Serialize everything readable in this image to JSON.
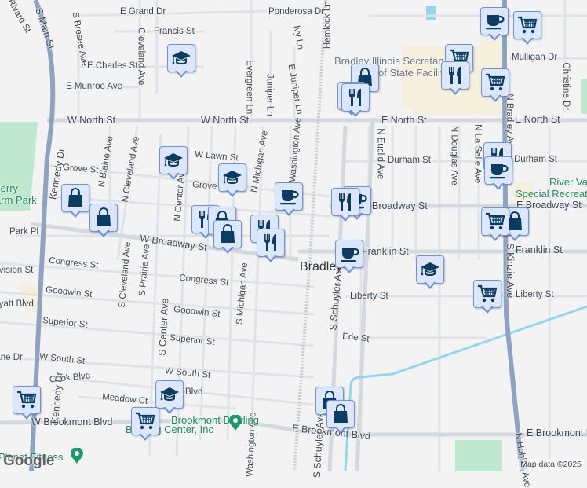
{
  "map": {
    "streets": [
      "E Grand Dr",
      "Francis St",
      "Ponderosa Dr",
      "Hemlock Ln",
      "Ivy Ln",
      "S Bresee Ave",
      "Cleveland Ave",
      "E Charles St",
      "E Munroe Ave",
      "Evergreen Ln",
      "Juniper Ln",
      "E Juniper Ln",
      "W North St",
      "W North St",
      "E North St",
      "E North St",
      "Mulligan Dr",
      "Christine Dr",
      "N Bradley Ave",
      "N Euclid Ave",
      "N Douglas Ave",
      "N La Salle Ave",
      "Durham St",
      "Durham St",
      "N Blaine Ave",
      "N Cleveland Ave",
      "W Lawn St",
      "Grove St",
      "Grove St",
      "N Center Ave",
      "N Michigan Ave",
      "Washington Ave",
      "E Broadway St",
      "Broadway St",
      "Park Pl",
      "W Broadway St",
      "Congress St",
      "Congress St",
      "Division St",
      "S Cleveland Ave",
      "S Prairie Ave",
      "Goodwin St",
      "Goodwin St",
      "Wyatt Blvd",
      "S Michigan Ave",
      "Superior St",
      "Superior St",
      "W South St",
      "W South St",
      "Lane Dr",
      "Cook Blvd",
      "Blvd",
      "Meadow Ct",
      "W Brookmont Blvd",
      "S Center Ave",
      "Franklin St",
      "Franklin St",
      "Liberty St",
      "Liberty St",
      "S Schuyler Ave",
      "Erie St",
      "S Kinzie Ave",
      "E Brookmont Blvd",
      "E Brookmont Blvd",
      "Washington Ave",
      "S Schuyler Ave",
      "N Hobbie Ave",
      "S Main St",
      "Kennedy Dr",
      "Kennedy Dr",
      "Rivard St"
    ],
    "places": [
      "Bradley Illinois Secretary",
      "of State Facility",
      "Perry",
      "Farm Park",
      "River Valley",
      "Special Recreation",
      "Brookmont Bowling",
      "Bowling Center, Inc",
      "Planet Fitness"
    ],
    "city_label": "Bradley",
    "attribution": "Map data ©2025",
    "logo": "Google",
    "markers": [
      {
        "type": "coffee"
      },
      {
        "type": "cart"
      },
      {
        "type": "school"
      },
      {
        "type": "cart"
      },
      {
        "type": "shopping"
      },
      {
        "type": "restaurant"
      },
      {
        "type": "cart"
      },
      {
        "type": "restaurant"
      },
      {
        "type": "restaurant"
      },
      {
        "type": "school"
      },
      {
        "type": "school"
      },
      {
        "type": "coffee"
      },
      {
        "type": "coffee"
      },
      {
        "type": "restaurant"
      },
      {
        "type": "restaurant"
      },
      {
        "type": "coffee"
      },
      {
        "type": "shopping"
      },
      {
        "type": "shopping"
      },
      {
        "type": "restaurant"
      },
      {
        "type": "shopping"
      },
      {
        "type": "shopping"
      },
      {
        "type": "restaurant"
      },
      {
        "type": "restaurant"
      },
      {
        "type": "shopping"
      },
      {
        "type": "cart"
      },
      {
        "type": "coffee"
      },
      {
        "type": "school"
      },
      {
        "type": "cart"
      },
      {
        "type": "school"
      },
      {
        "type": "shopping"
      },
      {
        "type": "shopping"
      },
      {
        "type": "cart"
      },
      {
        "type": "cart"
      }
    ],
    "colors": {
      "marker_bg": "#dce7fb",
      "marker_border": "#6b93dc",
      "icon": "#0b3d63",
      "highway": "#8da3c0",
      "water": "#8fd8ee",
      "park": "#bfe9cf",
      "facility": "#f6efdc"
    }
  }
}
